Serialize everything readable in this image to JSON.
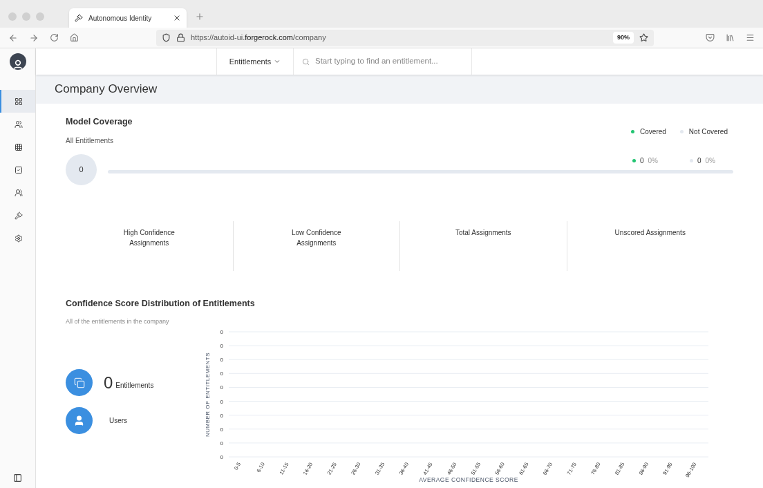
{
  "browser": {
    "tab_title": "Autonomous Identity",
    "url": "https://autoid-ui.**forgerock.com**/company",
    "zoom": "90%"
  },
  "sidebar": {
    "items": [
      {
        "kind": "dashboard",
        "selected": true
      },
      {
        "kind": "users",
        "selected": false
      },
      {
        "kind": "apps",
        "selected": false
      },
      {
        "kind": "tasks",
        "selected": false
      },
      {
        "kind": "groups",
        "selected": false
      },
      {
        "kind": "rules",
        "selected": false
      },
      {
        "kind": "settings",
        "selected": false
      }
    ]
  },
  "header": {
    "dropdown": "Entitlements",
    "search_placeholder": "Start typing to find an entitlement..."
  },
  "page_title": "Company Overview",
  "model_coverage": {
    "title": "Model Coverage",
    "subtitle": "All Entitlements",
    "count": "0",
    "legend": [
      {
        "label": "Covered",
        "color": "#22c472"
      },
      {
        "label": "Not Covered",
        "color": "#e3e8ef"
      }
    ],
    "readings": [
      {
        "value": "0",
        "percent": "0%",
        "color": "#22c472"
      },
      {
        "value": "0",
        "percent": "0%",
        "color": "#e3e8ef"
      }
    ]
  },
  "stats": [
    "High Confidence Assignments",
    "Low Confidence Assignments",
    "Total Assignments",
    "Unscored Assignments"
  ],
  "distribution": {
    "title": "Confidence Score Distribution of Entitlements",
    "subtitle": "All of the entitlements in the company",
    "entitlements_count": "0",
    "entitlements_label": "Entitlements",
    "users_label": "Users",
    "chart": {
      "xlabel": "AVERAGE CONFIDENCE SCORE",
      "ylabel": "NUMBER OF ENTITLEMENTS",
      "categories": [
        "0-5",
        "6-10",
        "11-15",
        "16-20",
        "21-25",
        "26-30",
        "31-35",
        "36-40",
        "41-45",
        "46-50",
        "51-55",
        "56-60",
        "61-65",
        "66-70",
        "71-75",
        "76-80",
        "81-85",
        "86-90",
        "91-95",
        "96-100"
      ],
      "ytick_labels": [
        "0",
        "0",
        "0",
        "0",
        "0",
        "0",
        "0",
        "0",
        "0",
        "0"
      ]
    }
  }
}
